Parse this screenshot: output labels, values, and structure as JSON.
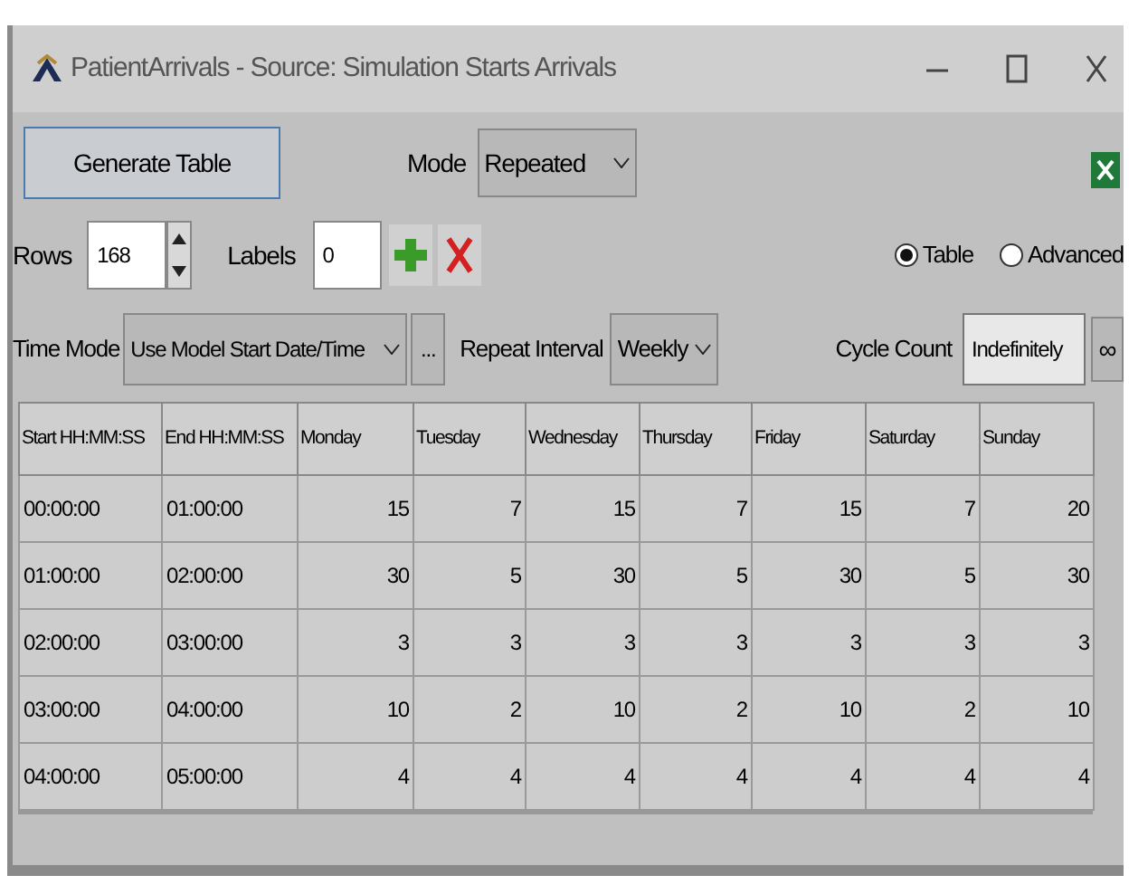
{
  "window": {
    "title": "PatientArrivals - Source: Simulation Starts Arrivals"
  },
  "generate_button": "Generate Table",
  "mode": {
    "label": "Mode",
    "value": "Repeated"
  },
  "rows": {
    "label": "Rows",
    "value": "168"
  },
  "labels": {
    "label": "Labels",
    "value": "0"
  },
  "view_options": [
    {
      "label": "Table",
      "selected": true
    },
    {
      "label": "Advanced",
      "selected": false
    }
  ],
  "time_mode": {
    "label": "Time Mode",
    "value": "Use Model Start Date/Time",
    "browse": "..."
  },
  "repeat_interval": {
    "label": "Repeat Interval",
    "value": "Weekly"
  },
  "cycle_count": {
    "label": "Cycle Count",
    "value": "Indefinitely",
    "button": "∞"
  },
  "table": {
    "columns": [
      "Start HH:MM:SS",
      "End HH:MM:SS",
      "Monday",
      "Tuesday",
      "Wednesday",
      "Thursday",
      "Friday",
      "Saturday",
      "Sunday"
    ],
    "rows": [
      [
        "00:00:00",
        "01:00:00",
        "15",
        "7",
        "15",
        "7",
        "15",
        "7",
        "20"
      ],
      [
        "01:00:00",
        "02:00:00",
        "30",
        "5",
        "30",
        "5",
        "30",
        "5",
        "30"
      ],
      [
        "02:00:00",
        "03:00:00",
        "3",
        "3",
        "3",
        "3",
        "3",
        "3",
        "3"
      ],
      [
        "03:00:00",
        "04:00:00",
        "10",
        "2",
        "10",
        "2",
        "10",
        "2",
        "10"
      ],
      [
        "04:00:00",
        "05:00:00",
        "4",
        "4",
        "4",
        "4",
        "4",
        "4",
        "4"
      ]
    ]
  }
}
